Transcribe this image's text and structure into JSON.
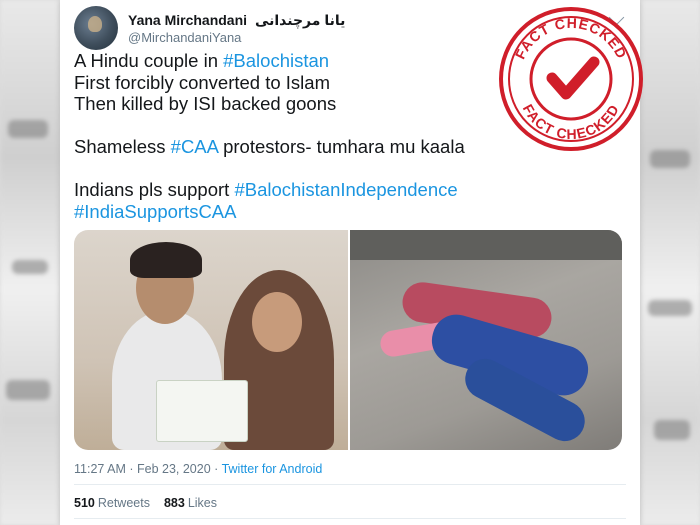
{
  "tweet": {
    "display_name": "Yana Mirchandani",
    "display_name_alt": "یانا مرچندانی",
    "handle": "@MirchandaniYana",
    "lines": [
      [
        {
          "t": "A Hindu couple in ",
          "h": false
        },
        {
          "t": "#Balochistan",
          "h": true
        }
      ],
      [
        {
          "t": "First forcibly converted to Islam",
          "h": false
        }
      ],
      [
        {
          "t": "Then killed by ISI backed goons",
          "h": false
        }
      ],
      [],
      [
        {
          "t": "Shameless ",
          "h": false
        },
        {
          "t": "#CAA",
          "h": true
        },
        {
          "t": " protestors- tumhara mu kaala",
          "h": false
        }
      ],
      [],
      [
        {
          "t": "Indians pls support ",
          "h": false
        },
        {
          "t": "#BalochistanIndependence",
          "h": true
        }
      ],
      [
        {
          "t": "#IndiaSupportsCAA",
          "h": true
        }
      ]
    ],
    "time": "11:27 AM · Feb 23, 2020",
    "separator": " · ",
    "client": "Twitter for Android",
    "retweets_count": "510",
    "retweets_label": "Retweets",
    "likes_count": "883",
    "likes_label": "Likes"
  },
  "stamp": {
    "top_text": "FACT CHECKED",
    "bottom_text": "FACT CHECKED",
    "color": "#d01e2a"
  },
  "colors": {
    "link": "#1b95e0",
    "text": "#14171a",
    "muted": "#657786"
  }
}
